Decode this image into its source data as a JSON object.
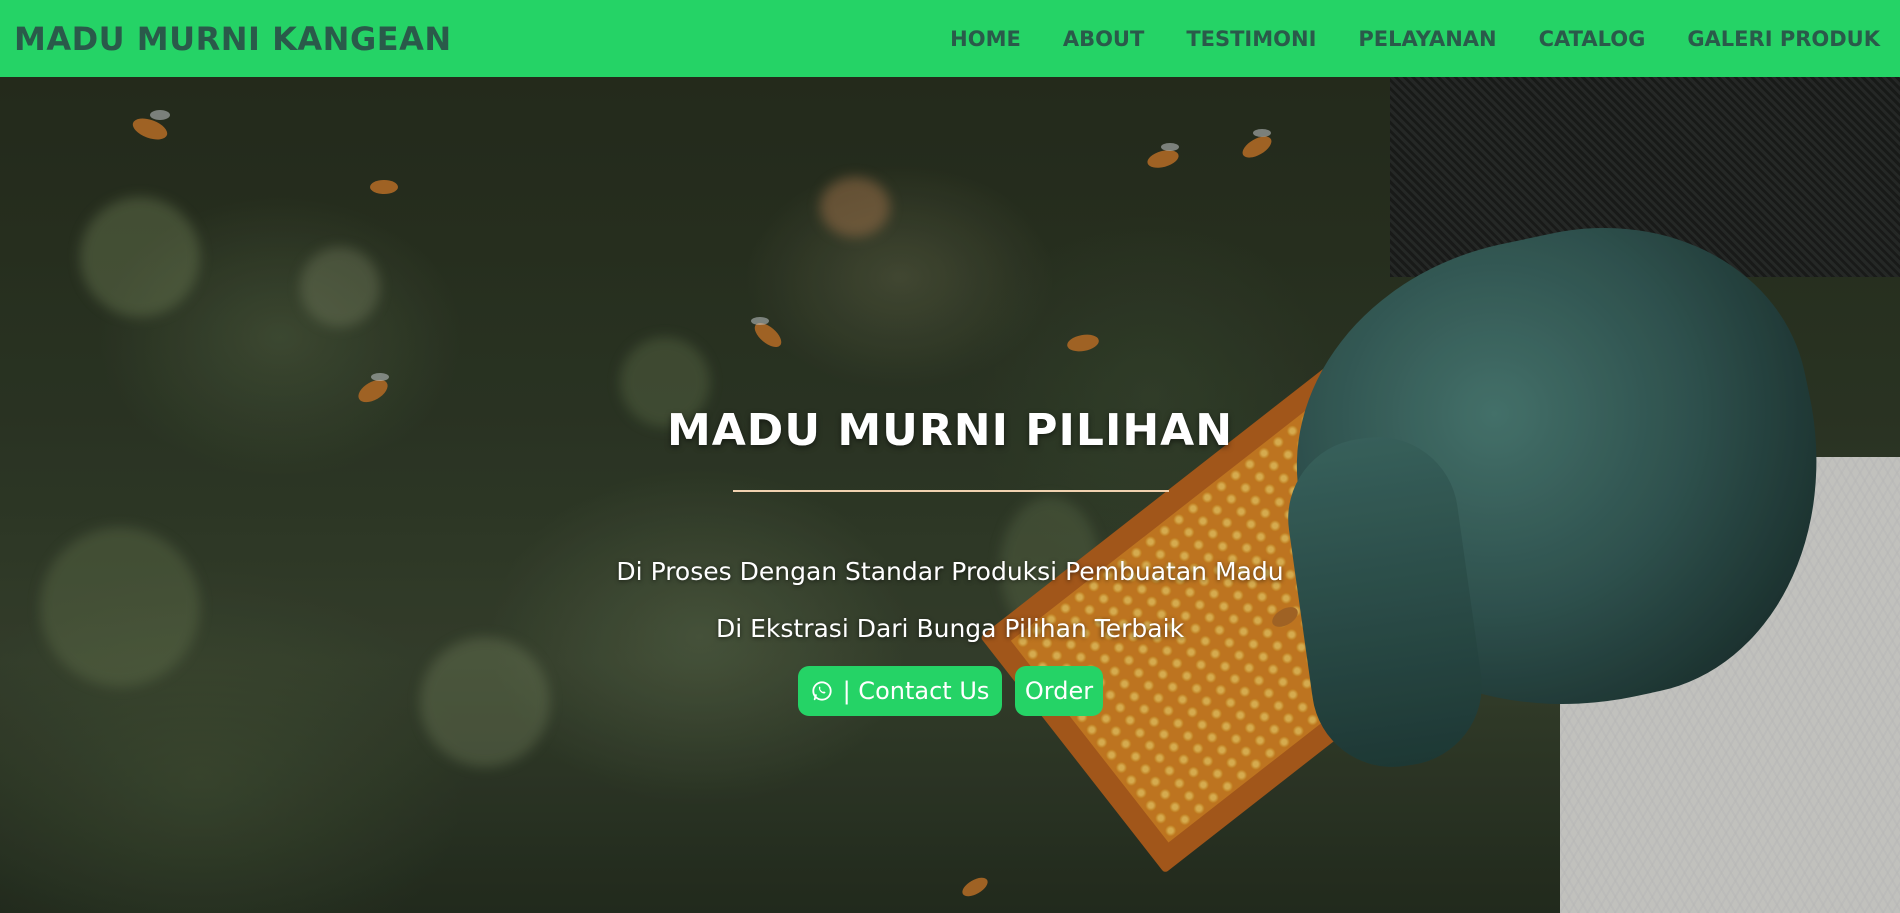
{
  "navbar": {
    "brand": "MADU MURNI KANGEAN",
    "items": [
      {
        "label": "HOME"
      },
      {
        "label": "ABOUT"
      },
      {
        "label": "TESTIMONI"
      },
      {
        "label": "PELAYANAN"
      },
      {
        "label": "CATALOG"
      },
      {
        "label": "GALERI PRODUK"
      }
    ]
  },
  "hero": {
    "title": "MADU MURNI PILIHAN",
    "line1": "Di Proses Dengan Standar Produksi Pembuatan Madu",
    "line2": "Di Ekstrasi Dari Bunga Pilihan Terbaik",
    "contact_label": "| Contact Us",
    "contact_icon": "whatsapp-icon",
    "order_label": "Order"
  },
  "colors": {
    "nav_bg": "#25d366",
    "nav_text": "#2a5a4a",
    "button_bg": "#25d366",
    "button_text": "#ffffff",
    "divider": "#f1d2b0"
  }
}
